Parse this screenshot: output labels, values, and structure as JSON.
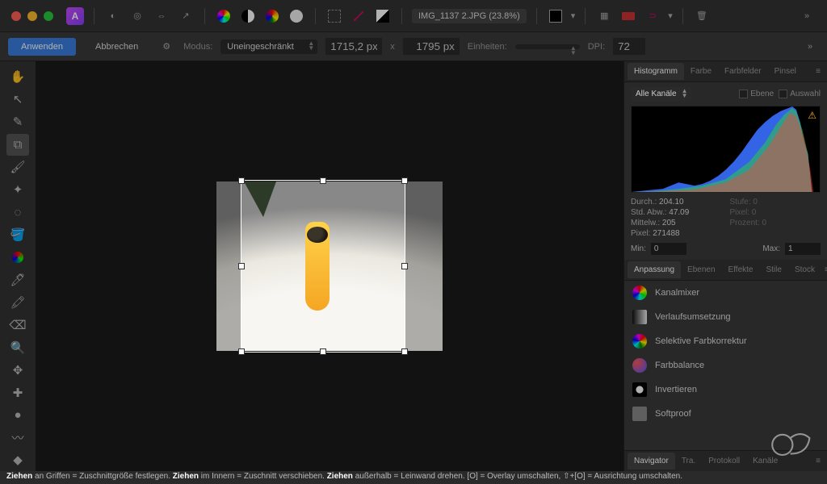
{
  "titlebar": {
    "document_title": "IMG_1137 2.JPG (23.8%)"
  },
  "contextbar": {
    "apply": "Anwenden",
    "cancel": "Abbrechen",
    "mode_label": "Modus:",
    "mode_value": "Uneingeschränkt",
    "width": "1715,2 px",
    "x": "x",
    "height": "1795 px",
    "units_label": "Einheiten:",
    "dpi_label": "DPI:",
    "dpi_value": "72"
  },
  "panels": {
    "histogram": {
      "tabs": [
        "Histogramm",
        "Farbe",
        "Farbfelder",
        "Pinsel"
      ],
      "active_tab": 0,
      "channel_select": "Alle Kanäle",
      "chk_layer": "Ebene",
      "chk_selection": "Auswahl",
      "stats": {
        "durch_label": "Durch.:",
        "durch": "204.10",
        "stufe_label": "Stufe:",
        "stufe": "0",
        "std_label": "Std. Abw.:",
        "std": "47.09",
        "pixel2_label": "Pixel:",
        "pixel2": "0",
        "mittel_label": "Mittelw.:",
        "mittel": "205",
        "prozent_label": "Prozent:",
        "prozent": "0",
        "pixel_label": "Pixel:",
        "pixel": "271488"
      },
      "min_label": "Min:",
      "min_value": "0",
      "max_label": "Max:",
      "max_value": "1"
    },
    "adjust": {
      "tabs": [
        "Anpassung",
        "Ebenen",
        "Effekte",
        "Stile",
        "Stock"
      ],
      "active_tab": 0,
      "items": [
        {
          "label": "Kanalmixer"
        },
        {
          "label": "Verlaufsumsetzung"
        },
        {
          "label": "Selektive Farbkorrektur"
        },
        {
          "label": "Farbbalance"
        },
        {
          "label": "Invertieren"
        },
        {
          "label": "Softproof"
        }
      ]
    },
    "nav": {
      "tabs": [
        "Navigator",
        "Tra.",
        "Protokoll",
        "Kanäle"
      ],
      "active_tab": 0
    }
  },
  "status": {
    "t1": "Ziehen",
    "s1": " an Griffen = Zuschnittgröße festlegen. ",
    "t2": "Ziehen",
    "s2": " im Innern = Zuschnitt verschieben. ",
    "t3": "Ziehen",
    "s3": " außerhalb = Leinwand drehen. [O] = Overlay umschalten, ⇧+[O] = Ausrichtung umschalten."
  }
}
